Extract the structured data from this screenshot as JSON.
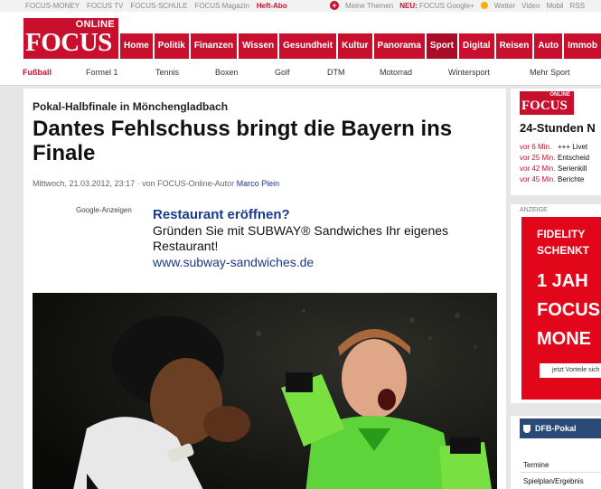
{
  "topbar": {
    "links": [
      "FOCUS-MONEY",
      "FOCUS TV",
      "FOCUS-SCHULE",
      "FOCUS Magazin",
      "Heft-Abo"
    ],
    "meine_themen": "Meine Themen",
    "neu": "NEU:",
    "google_plus": "FOCUS Google+",
    "weather": "Wetter",
    "video": "Video",
    "mobil": "Mobil",
    "rss": "RSS"
  },
  "logo": {
    "online": "ONLINE",
    "focus": "FOCUS"
  },
  "main_nav": [
    "Home",
    "Politik",
    "Finanzen",
    "Wissen",
    "Gesundheit",
    "Kultur",
    "Panorama",
    "Sport",
    "Digital",
    "Reisen",
    "Auto",
    "Immob"
  ],
  "main_nav_active": "Sport",
  "sub_nav": [
    "Fußball",
    "Formel 1",
    "Tennis",
    "Boxen",
    "Golf",
    "DTM",
    "Motorrad",
    "Wintersport",
    "Mehr Sport"
  ],
  "article": {
    "kicker": "Pokal-Halbfinale in Mönchengladbach",
    "title": "Dantes Fehlschuss bringt die Bayern ins Finale",
    "date": "Mittwoch, 21.03.2012, 23:17",
    "author_prefix": "· von FOCUS-Online-Autor",
    "author": "Marco Plein"
  },
  "ad": {
    "label": "Google-Anzeigen",
    "headline": "Restaurant eröffnen?",
    "text": "Gründen Sie mit SUBWAY® Sandwiches Ihr eigenes Restaurant!",
    "url": "www.subway-sandwiches.de"
  },
  "news_box": {
    "logo_online": "ONLINE",
    "logo_focus": "FOCUS",
    "title": "24-Stunden N",
    "items": [
      {
        "time": "vor 6 Min.",
        "text": "+++ Livet"
      },
      {
        "time": "vor 25 Min.",
        "text": "Entscheid"
      },
      {
        "time": "vor 42 Min.",
        "text": "Serienkill"
      },
      {
        "time": "vor 45 Min.",
        "text": "Berichte"
      }
    ]
  },
  "side_ad": {
    "label": "ANZEIGE",
    "lines": [
      "FIDELITY",
      "SCHENKT",
      "1 JAH",
      "FOCUS",
      "MONE"
    ],
    "button": "jetzt Vorteile sich"
  },
  "dfb": {
    "title": "DFB-Pokal",
    "items": [
      "Termine",
      "Spielplan/Ergebnis"
    ]
  },
  "colors": {
    "brand_red": "#c8102e",
    "link_blue": "#1a3a8a",
    "nav_blue": "#2a4a78"
  }
}
